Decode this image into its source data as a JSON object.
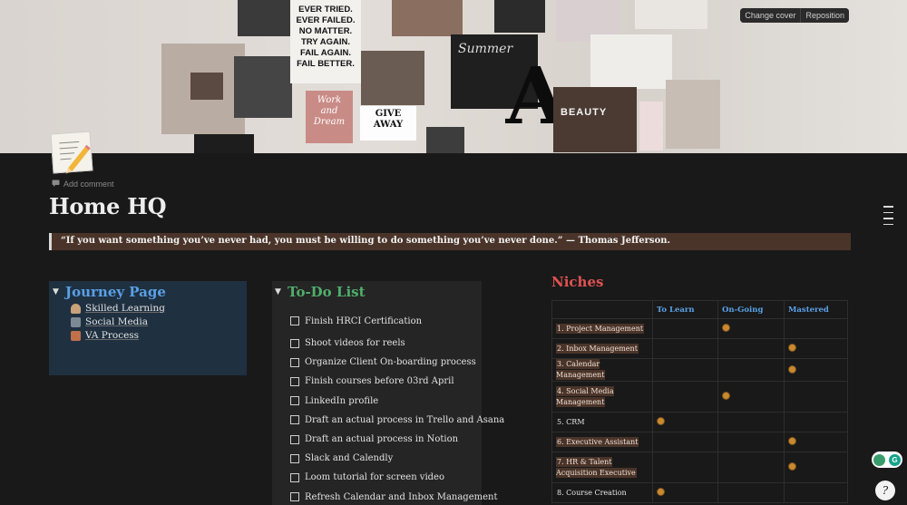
{
  "cover": {
    "buttons": {
      "change_cover": "Change cover",
      "reposition": "Reposition"
    },
    "collage_text": {
      "poster": "EVER TRIED.\nEVER FAILED.\nNO MATTER.\nTRY AGAIN.\nFAIL AGAIN.\nFAIL BETTER.",
      "summer": "Summer",
      "letter": "A",
      "beauty": "BEAUTY",
      "giveaway": "GIVE\nAWAY",
      "work_dream": "Work\nand\nDream"
    }
  },
  "page": {
    "add_comment": "Add comment",
    "title": "Home HQ",
    "quote": "“If you want something you’ve never had, you must be willing to do something you’ve never done.” — Thomas Jefferson."
  },
  "journey": {
    "title": "Journey Page",
    "items": [
      {
        "label": "Skilled Learning",
        "icon": "coffee-icon",
        "color": "#c8a27a"
      },
      {
        "label": "Social Media",
        "icon": "people-icon",
        "color": "#7d8a94"
      },
      {
        "label": "VA Process",
        "icon": "document-icon",
        "color": "#c0714a"
      }
    ]
  },
  "todo": {
    "title": "To-Do List",
    "items": [
      "Finish HRCI Certification",
      "Shoot videos for reels",
      "Organize Client On-boarding process",
      "Finish courses before 03rd April",
      "LinkedIn profile",
      "Draft an actual process in Trello and Asana",
      "Draft an actual process in Notion",
      "Slack and Calendly",
      "Loom tutorial for screen video",
      "Refresh Calendar and Inbox Management"
    ]
  },
  "niches": {
    "title": "Niches",
    "headers": [
      "",
      "To Learn",
      "On-Going",
      "Mastered"
    ],
    "header_color": "#5aa0e6",
    "rows": [
      {
        "label": "1. Project Management",
        "highlight": true,
        "status": "ongoing"
      },
      {
        "label": "2. Inbox Management",
        "highlight": true,
        "status": "mastered"
      },
      {
        "label": "3. Calendar Management",
        "highlight": true,
        "status": "mastered"
      },
      {
        "label": "4. Social Media Management",
        "highlight": true,
        "status": "ongoing",
        "tall": true
      },
      {
        "label": "5. CRM",
        "highlight": false,
        "status": "learn"
      },
      {
        "label": "6. Executive Assistant",
        "highlight": true,
        "status": "mastered"
      },
      {
        "label": "7. HR & Talent Acquisition Executive",
        "highlight": true,
        "status": "mastered",
        "tall": true
      },
      {
        "label": "8. Course Creation",
        "highlight": false,
        "status": "learn"
      }
    ]
  },
  "extension": {
    "left_letter": "",
    "right_letter": "G"
  },
  "help": {
    "label": "?"
  }
}
